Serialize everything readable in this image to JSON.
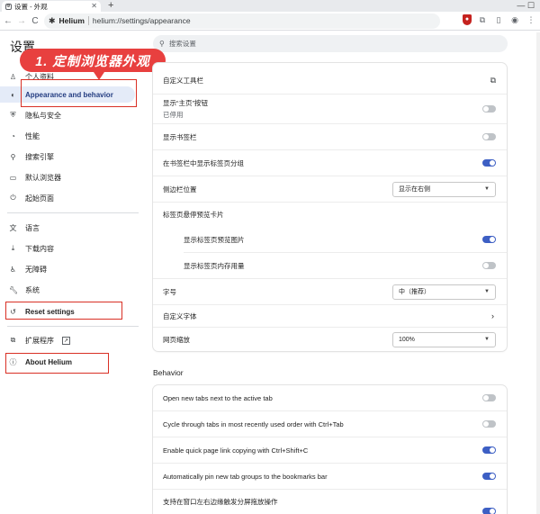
{
  "browser": {
    "tab_title": "设置 - 外观",
    "tab_close": "✕",
    "new_tab": "+",
    "window_controls": "—  ☐",
    "back": "←",
    "forward": "→",
    "reload": "C",
    "site_name": "Helium",
    "url": "helium://settings/appearance"
  },
  "header": {
    "title": "设置",
    "search_placeholder": "搜索设置"
  },
  "annotation": {
    "banner_text": "1. 定制浏览器外观",
    "color": "#e8403f"
  },
  "sidebar": {
    "items": [
      {
        "label": "个人资料",
        "icon": "person-icon"
      },
      {
        "label": "Appearance and behavior",
        "icon": "palette-icon"
      },
      {
        "label": "隐私与安全",
        "icon": "shield-icon"
      },
      {
        "label": "性能",
        "icon": "speedometer-icon"
      },
      {
        "label": "搜索引擎",
        "icon": "search-icon"
      },
      {
        "label": "默认浏览器",
        "icon": "browser-icon"
      },
      {
        "label": "起始页面",
        "icon": "power-icon"
      },
      {
        "label": "语言",
        "icon": "translate-icon"
      },
      {
        "label": "下载内容",
        "icon": "download-icon"
      },
      {
        "label": "无障碍",
        "icon": "accessibility-icon"
      },
      {
        "label": "系统",
        "icon": "wrench-icon"
      },
      {
        "label": "Reset settings",
        "icon": "reset-icon"
      },
      {
        "label": "扩展程序",
        "icon": "puzzle-icon"
      },
      {
        "label": "About Helium",
        "icon": "info-icon"
      }
    ]
  },
  "appearance": {
    "rows": [
      {
        "label": "自定义工具栏",
        "control": "external-link"
      },
      {
        "label": "显示“主页”按钮",
        "sublabel": "已停用",
        "control": "toggle",
        "value": false
      },
      {
        "label": "显示书签栏",
        "control": "toggle",
        "value": false
      },
      {
        "label": "在书签栏中显示标签页分组",
        "control": "toggle",
        "value": true
      },
      {
        "label": "侧边栏位置",
        "control": "select",
        "value": "显示在右侧"
      },
      {
        "label": "标签页悬停预览卡片",
        "control": "none"
      },
      {
        "label": "显示标签页预览图片",
        "control": "toggle",
        "value": true
      },
      {
        "label": "显示标签页内存用量",
        "control": "toggle",
        "value": false
      },
      {
        "label": "字号",
        "control": "select",
        "value": "中（推荐）"
      },
      {
        "label": "自定义字体",
        "control": "arrow"
      },
      {
        "label": "网页缩放",
        "control": "select",
        "value": "100%"
      }
    ]
  },
  "behavior": {
    "title": "Behavior",
    "rows": [
      {
        "label": "Open new tabs next to the active tab",
        "value": false
      },
      {
        "label": "Cycle through tabs in most recently used order with Ctrl+Tab",
        "value": false
      },
      {
        "label": "Enable quick page link copying with Ctrl+Shift+C",
        "value": true
      },
      {
        "label": "Automatically pin new tab groups to the bookmarks bar",
        "value": true
      },
      {
        "label": "支持在窗口左右边缘触发分屏拖放操作",
        "value": true
      }
    ]
  },
  "colors": {
    "accent": "#3d5fc4",
    "highlight_box": "#d93025"
  }
}
